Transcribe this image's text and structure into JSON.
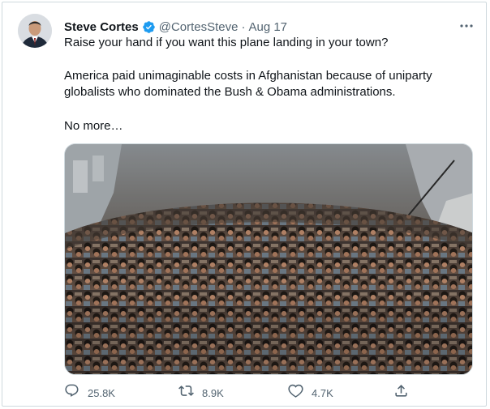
{
  "tweet": {
    "author_name": "Steve Cortes",
    "handle": "@CortesSteve",
    "separator": "·",
    "date": "Aug 17",
    "text_lines": [
      "Raise your hand if you want this plane landing in your town?",
      "America paid unimaginable costs in Afghanistan because of uniparty",
      "globalists who dominated the Bush & Obama administrations.",
      "No more…"
    ],
    "stats": {
      "replies": "25.8K",
      "retweets": "8.9K",
      "likes": "4.7K"
    }
  },
  "colors": {
    "verified": "#1d9bf0",
    "secondary_text": "#536471",
    "border": "#cfd9de"
  },
  "icons": [
    "verified-badge-icon",
    "more-options-icon",
    "reply-icon",
    "retweet-icon",
    "like-icon",
    "share-icon"
  ]
}
